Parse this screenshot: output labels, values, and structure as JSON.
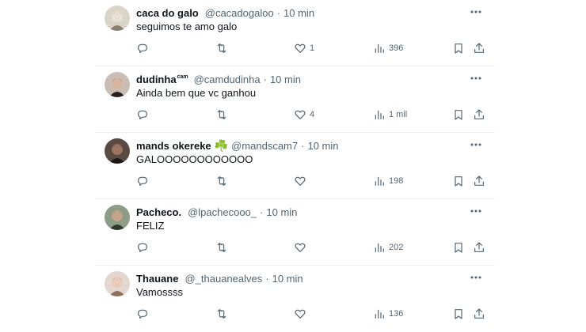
{
  "tweets": [
    {
      "name": "caca do galo",
      "name_badge": "",
      "emoji": "",
      "handle": "@cacadogaloo",
      "time": "10 min",
      "text": "seguimos te amo galo",
      "likes": "1",
      "views": "396",
      "avatar": {
        "bg": "#d9d4c8",
        "fg": "#8a7f70",
        "skin": "#e9dfd2"
      }
    },
    {
      "name": "dudinha",
      "name_badge": "cam",
      "emoji": "",
      "handle": "@camdudinha",
      "time": "10 min",
      "text": "Ainda bem que vc ganhou",
      "likes": "4",
      "views": "1 mil",
      "avatar": {
        "bg": "#c9bdb6",
        "fg": "#2b2220",
        "skin": "#d8b7a2"
      }
    },
    {
      "name": "mands okereke",
      "name_badge": "",
      "emoji": "☘️",
      "handle": "@mandscam7",
      "time": "10 min",
      "text": "GALOOOOOOOOOOOO",
      "likes": "",
      "views": "198",
      "avatar": {
        "bg": "#5a4a44",
        "fg": "#1d1614",
        "skin": "#9b7560"
      }
    },
    {
      "name": "Pacheco.",
      "name_badge": "",
      "emoji": "",
      "handle": "@lpachecooo_",
      "time": "10 min",
      "text": "FELIZ",
      "likes": "",
      "views": "202",
      "avatar": {
        "bg": "#8e9b86",
        "fg": "#2f3a2c",
        "skin": "#c4a58a"
      }
    },
    {
      "name": "Thauane",
      "name_badge": "",
      "emoji": "",
      "handle": "@_thauanealves",
      "time": "10 min",
      "text": "Vamossss",
      "likes": "",
      "views": "136",
      "avatar": {
        "bg": "#e3d7cf",
        "fg": "#8c6f5c",
        "skin": "#e8cbb8"
      }
    }
  ],
  "dot": "·"
}
